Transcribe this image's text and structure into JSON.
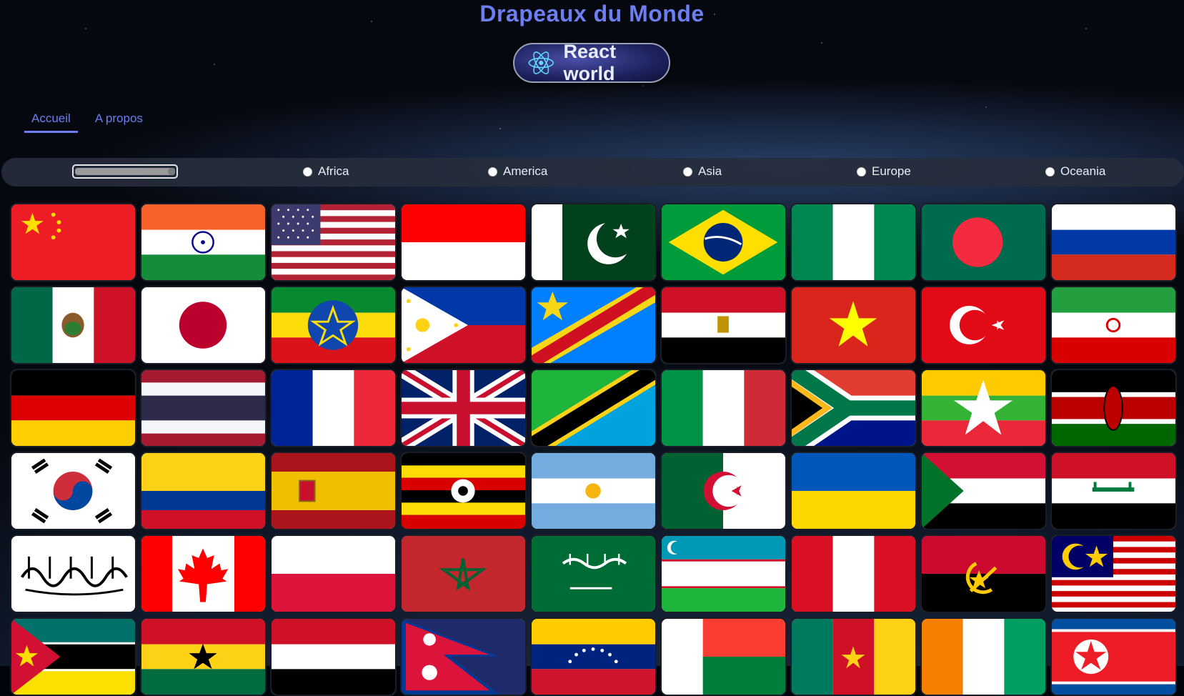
{
  "header": {
    "title": "Drapeaux du Monde",
    "badge_label": "React world"
  },
  "nav": {
    "items": [
      {
        "label": "Accueil",
        "active": true
      },
      {
        "label": "A propos",
        "active": false
      }
    ]
  },
  "filters": {
    "range_value": 100,
    "regions": [
      "Africa",
      "America",
      "Asia",
      "Europe",
      "Oceania"
    ]
  },
  "flags": [
    {
      "country": "China"
    },
    {
      "country": "India"
    },
    {
      "country": "United States"
    },
    {
      "country": "Indonesia"
    },
    {
      "country": "Pakistan"
    },
    {
      "country": "Brazil"
    },
    {
      "country": "Nigeria"
    },
    {
      "country": "Bangladesh"
    },
    {
      "country": "Russia"
    },
    {
      "country": "Mexico"
    },
    {
      "country": "Japan"
    },
    {
      "country": "Ethiopia"
    },
    {
      "country": "Philippines"
    },
    {
      "country": "DR Congo"
    },
    {
      "country": "Egypt"
    },
    {
      "country": "Vietnam"
    },
    {
      "country": "Turkey"
    },
    {
      "country": "Iran"
    },
    {
      "country": "Germany"
    },
    {
      "country": "Thailand"
    },
    {
      "country": "France"
    },
    {
      "country": "United Kingdom"
    },
    {
      "country": "Tanzania"
    },
    {
      "country": "Italy"
    },
    {
      "country": "South Africa"
    },
    {
      "country": "Myanmar"
    },
    {
      "country": "Kenya"
    },
    {
      "country": "South Korea"
    },
    {
      "country": "Colombia"
    },
    {
      "country": "Spain"
    },
    {
      "country": "Uganda"
    },
    {
      "country": "Argentina"
    },
    {
      "country": "Algeria"
    },
    {
      "country": "Ukraine"
    },
    {
      "country": "Sudan"
    },
    {
      "country": "Iraq"
    },
    {
      "country": "Afghanistan"
    },
    {
      "country": "Canada"
    },
    {
      "country": "Poland"
    },
    {
      "country": "Morocco"
    },
    {
      "country": "Saudi Arabia"
    },
    {
      "country": "Uzbekistan"
    },
    {
      "country": "Peru"
    },
    {
      "country": "Angola"
    },
    {
      "country": "Malaysia"
    },
    {
      "country": "Mozambique"
    },
    {
      "country": "Ghana"
    },
    {
      "country": "Yemen"
    },
    {
      "country": "Nepal"
    },
    {
      "country": "Venezuela"
    },
    {
      "country": "Madagascar"
    },
    {
      "country": "Cameroon"
    },
    {
      "country": "Côte d'Ivoire"
    },
    {
      "country": "North Korea"
    }
  ],
  "colors": {
    "accent": "#6c7ef0",
    "filterbar": "#262c3c"
  }
}
